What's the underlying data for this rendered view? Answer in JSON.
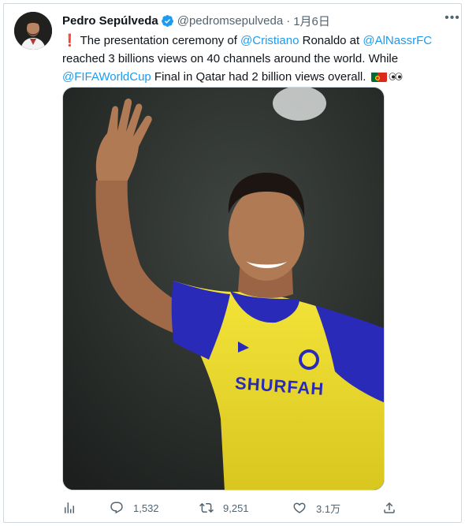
{
  "tweet": {
    "author_name": "Pedro Sepúlveda",
    "handle": "@pedromsepulveda",
    "separator": "·",
    "date": "1月6日",
    "more_label": "•••",
    "text": {
      "exclamation": "❗",
      "part1": " The presentation ceremony of ",
      "mention1": "@Cristiano",
      "part2": " Ronaldo at ",
      "mention2": "@AlNassrFC",
      "part3": " reached 3 billions views on 40 channels around the world. While ",
      "mention3": "@FIFAWorldCup",
      "part4": " Final in Qatar had 2 billion views overall. "
    },
    "media": {
      "jersey_text": "SHURFAH"
    },
    "actions": {
      "replies": "1,532",
      "retweets": "9,251",
      "likes": "3.1万"
    },
    "colors": {
      "link": "#1d9bf0",
      "muted": "#536471",
      "verified": "#1d9bf0",
      "jersey_yellow": "#f2e02c",
      "jersey_blue": "#2a2ab8"
    }
  }
}
